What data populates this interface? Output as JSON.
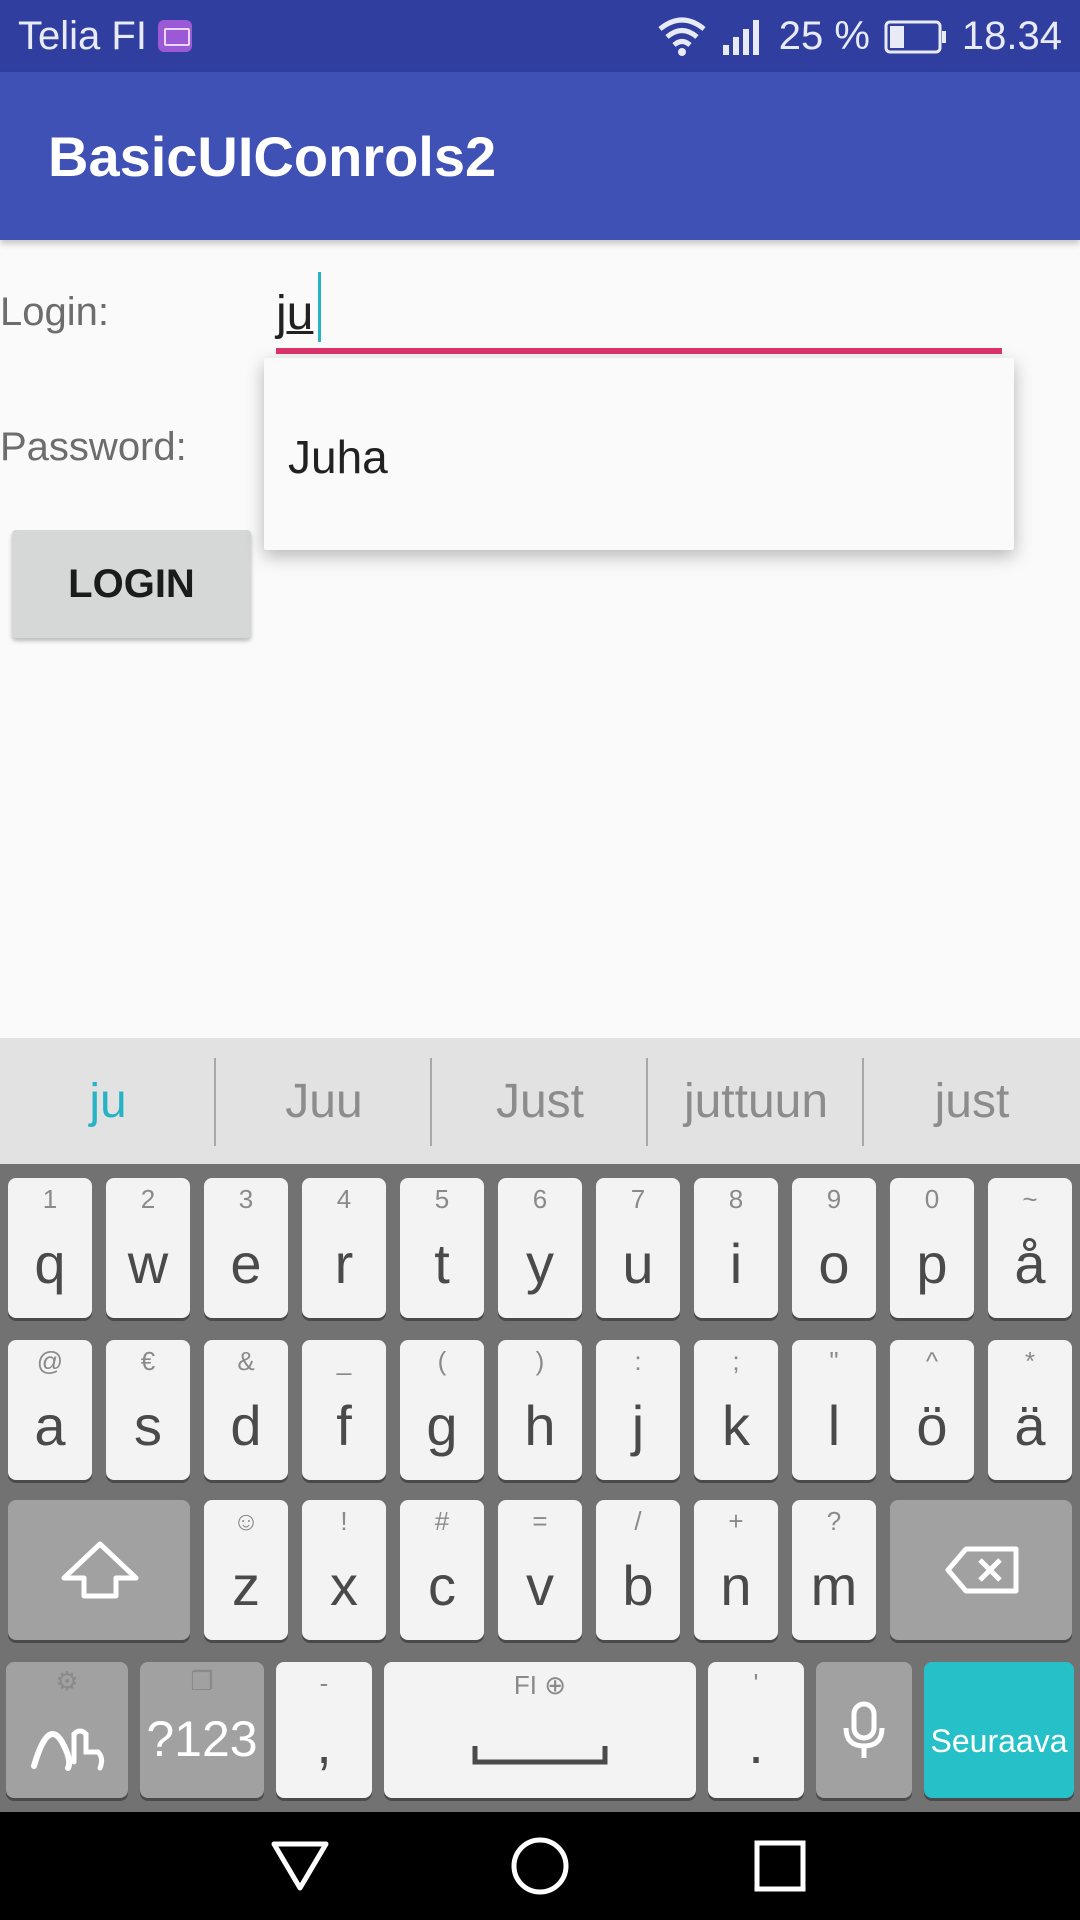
{
  "status_bar": {
    "carrier": "Telia FI",
    "battery_percent": "25 %",
    "time": "18.34"
  },
  "app_bar": {
    "title": "BasicUIConrols2"
  },
  "form": {
    "login_label": "Login:",
    "login_value": "ju",
    "password_label": "Password:",
    "login_button": "LOGIN"
  },
  "autocomplete": {
    "items": [
      "Juha"
    ]
  },
  "keyboard": {
    "suggestions": [
      "ju",
      "Juu",
      "Just",
      "juttuun",
      "just"
    ],
    "row1": [
      {
        "main": "q",
        "alt": "1"
      },
      {
        "main": "w",
        "alt": "2"
      },
      {
        "main": "e",
        "alt": "3"
      },
      {
        "main": "r",
        "alt": "4"
      },
      {
        "main": "t",
        "alt": "5"
      },
      {
        "main": "y",
        "alt": "6"
      },
      {
        "main": "u",
        "alt": "7"
      },
      {
        "main": "i",
        "alt": "8"
      },
      {
        "main": "o",
        "alt": "9"
      },
      {
        "main": "p",
        "alt": "0"
      },
      {
        "main": "å",
        "alt": "~"
      }
    ],
    "row2": [
      {
        "main": "a",
        "alt": "@"
      },
      {
        "main": "s",
        "alt": "€"
      },
      {
        "main": "d",
        "alt": "&"
      },
      {
        "main": "f",
        "alt": "_"
      },
      {
        "main": "g",
        "alt": "("
      },
      {
        "main": "h",
        "alt": ")"
      },
      {
        "main": "j",
        "alt": ":"
      },
      {
        "main": "k",
        "alt": ";"
      },
      {
        "main": "l",
        "alt": "\""
      },
      {
        "main": "ö",
        "alt": "^"
      },
      {
        "main": "ä",
        "alt": "*"
      }
    ],
    "row3": [
      {
        "main": "z",
        "alt": "☺"
      },
      {
        "main": "x",
        "alt": "!"
      },
      {
        "main": "c",
        "alt": "#"
      },
      {
        "main": "v",
        "alt": "="
      },
      {
        "main": "b",
        "alt": "/"
      },
      {
        "main": "n",
        "alt": "+"
      },
      {
        "main": "m",
        "alt": "?"
      }
    ],
    "symbols_key": "?123",
    "comma_key": {
      "main": ",",
      "alt": "-"
    },
    "space_key_label": "FI",
    "period_key": {
      "main": ".",
      "alt": "'"
    },
    "action_key": "Seuraava"
  },
  "colors": {
    "status_bar": "#303f9f",
    "app_bar": "#3f51b5",
    "accent_underline": "#e0336e",
    "keyboard_accent": "#26c0c9"
  },
  "icons": [
    "wifi-icon",
    "signal-icon",
    "battery-icon",
    "keyboard-notification-icon",
    "shift-icon",
    "backspace-icon",
    "gesture-settings-icon",
    "globe-icon",
    "microphone-icon",
    "nav-back-icon",
    "nav-home-icon",
    "nav-recents-icon"
  ]
}
